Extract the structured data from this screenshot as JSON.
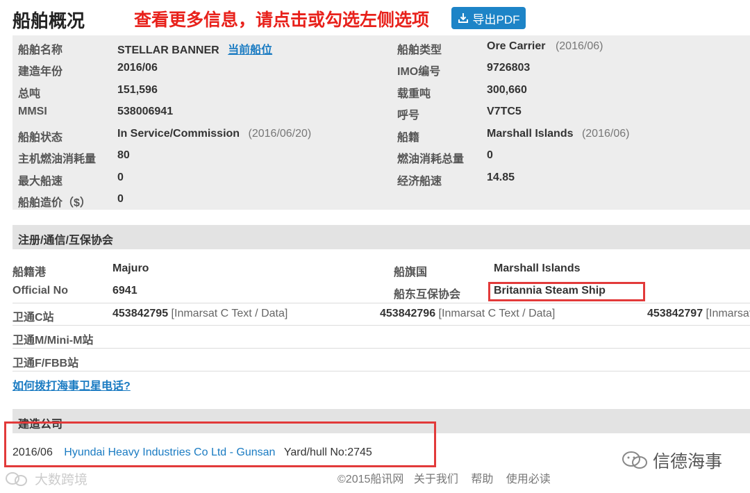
{
  "header": {
    "title": "船舶概况",
    "notice": "查看更多信息，请点击或勾选左侧选项",
    "export_label": "导出PDF"
  },
  "overview": {
    "left": [
      {
        "label": "船舶名称",
        "value": "STELLAR BANNER",
        "link": "当前船位",
        "sub": ""
      },
      {
        "label": "建造年份",
        "value": "2016/06",
        "sub": ""
      },
      {
        "label": "总吨",
        "value": "151,596",
        "sub": ""
      },
      {
        "label": "MMSI",
        "value": "538006941",
        "sub": ""
      },
      {
        "label": "船舶状态",
        "value": "In Service/Commission",
        "sub": "(2016/06/20)"
      },
      {
        "label": "主机燃油消耗量",
        "value": "80",
        "sub": ""
      },
      {
        "label": "最大船速",
        "value": "0",
        "sub": ""
      },
      {
        "label": "船舶造价（$）",
        "value": "0",
        "sub": ""
      }
    ],
    "right": [
      {
        "label": "船舶类型",
        "value": "Ore Carrier",
        "sub": "(2016/06)"
      },
      {
        "label": "IMO编号",
        "value": "9726803",
        "sub": ""
      },
      {
        "label": "载重吨",
        "value": "300,660",
        "sub": ""
      },
      {
        "label": "呼号",
        "value": "V7TC5",
        "sub": ""
      },
      {
        "label": "船籍",
        "value": "Marshall Islands",
        "sub": "(2016/06)"
      },
      {
        "label": "燃油消耗总量",
        "value": "0",
        "sub": ""
      },
      {
        "label": "经济船速",
        "value": "14.85",
        "sub": ""
      }
    ]
  },
  "registration": {
    "section_title": "注册/通信/互保协会",
    "port_label": "船籍港",
    "port_value": "Majuro",
    "flag_label": "船旗国",
    "flag_value": "Marshall Islands",
    "official_label": "Official No",
    "official_value": "6941",
    "pi_label": "船东互保协会",
    "pi_value": "Britannia Steam Ship",
    "inmc_label": "卫通C站",
    "inmc": [
      {
        "number": "453842795",
        "type": "[Inmarsat C Text / Data]"
      },
      {
        "number": "453842796",
        "type": "[Inmarsat C Text / Data]"
      },
      {
        "number": "453842797",
        "type": "[Inmarsat C Text / Data]"
      }
    ],
    "inmm_label": "卫通M/Mini-M站",
    "inmf_label": "卫通F/FBB站",
    "help_link": "如何拨打海事卫星电话?"
  },
  "builder": {
    "section_title": "建造公司",
    "date": "2016/06",
    "company": "Hyundai Heavy Industries Co Ltd - Gunsan",
    "yard": "Yard/hull No:2745"
  },
  "footer": {
    "copyright": "©2015船讯网",
    "links": [
      "关于我们",
      "帮助",
      "使用必读"
    ]
  },
  "watermarks": {
    "right": "信德海事",
    "left": "大数跨境"
  },
  "colors": {
    "accent": "#1d84c7",
    "highlight_red": "#e23a3a",
    "notice_red": "#e8211b"
  }
}
